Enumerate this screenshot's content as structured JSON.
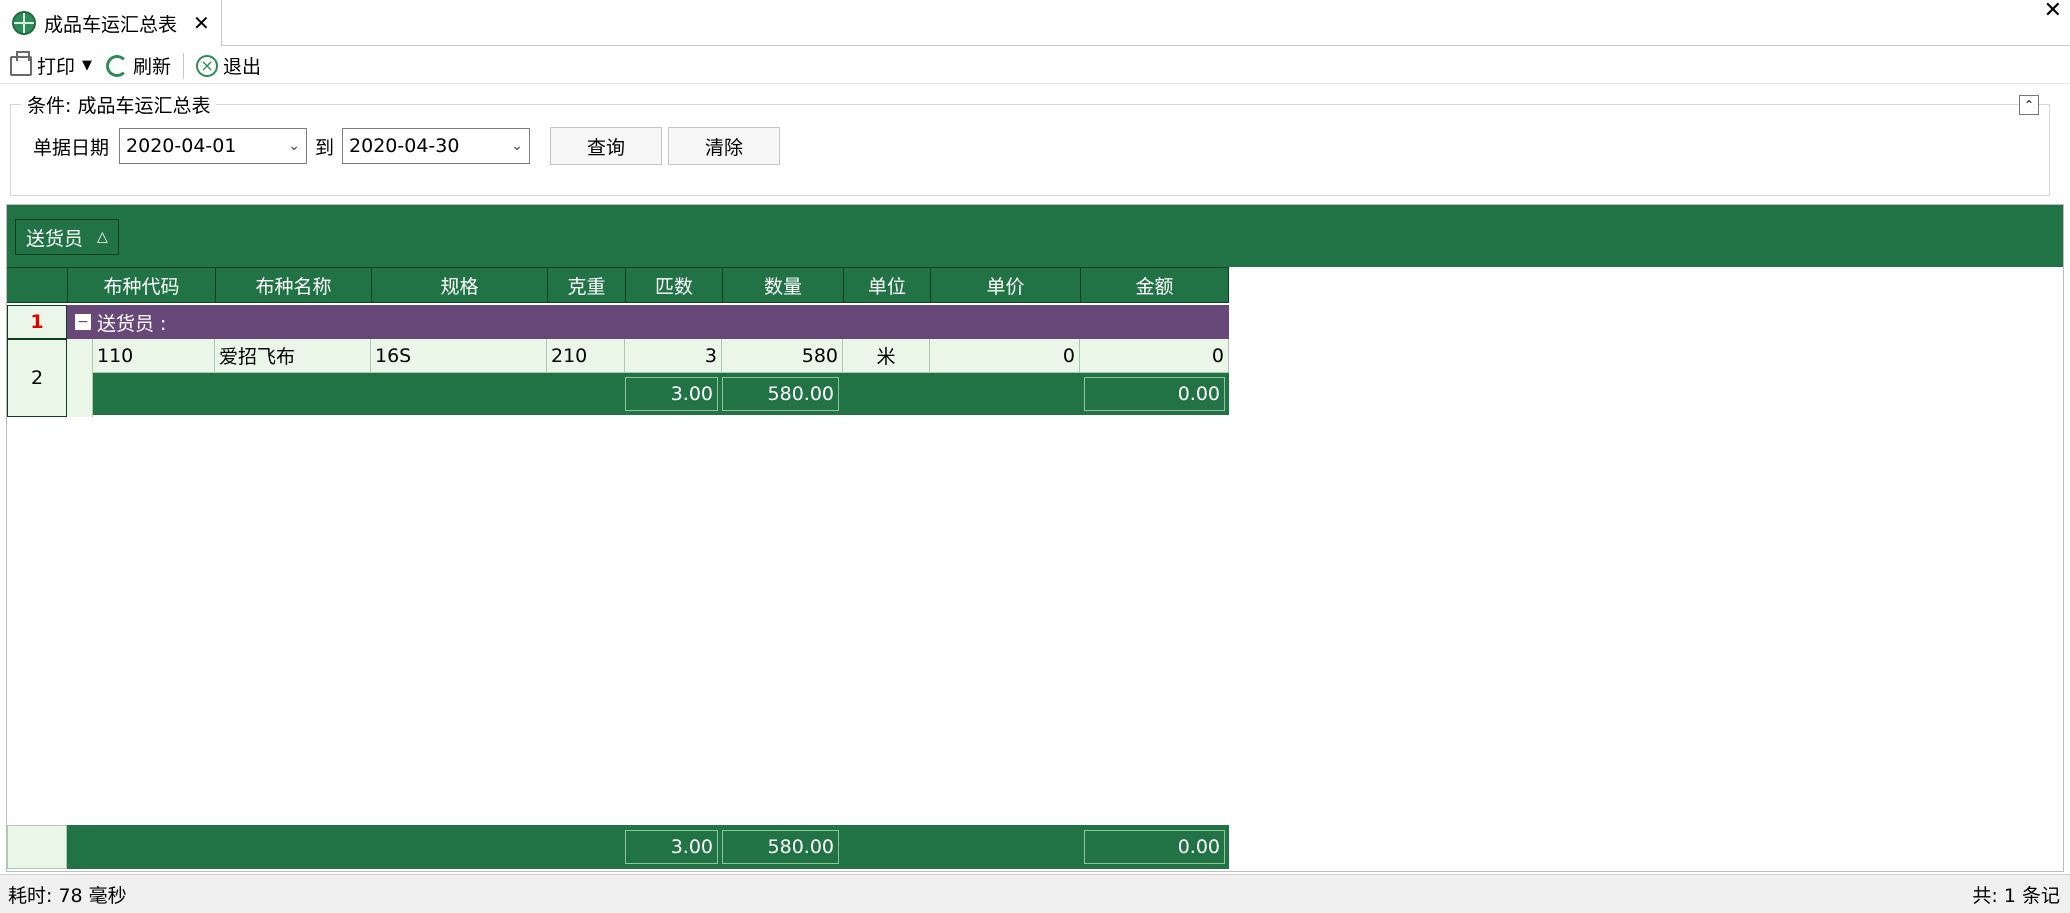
{
  "tab": {
    "title": "成品车运汇总表",
    "close": "✕"
  },
  "window": {
    "close": "✕"
  },
  "toolbar": {
    "print": "打印",
    "refresh": "刷新",
    "exit": "退出"
  },
  "condition": {
    "legend": "条件: 成品车运汇总表",
    "date_label": "单据日期",
    "date_from": "2020-04-01",
    "to_label": "到",
    "date_to": "2020-04-30",
    "query_button": "查询",
    "clear_button": "清除"
  },
  "grid": {
    "group_by": "送货员",
    "columns": [
      "布种代码",
      "布种名称",
      "规格",
      "克重",
      "匹数",
      "数量",
      "单位",
      "单价",
      "金额"
    ],
    "group_row": {
      "indicator": "1",
      "label": "送货员 :"
    },
    "rows": [
      {
        "indicator": "2",
        "code": "110",
        "name": "爱招飞布",
        "spec": "16S",
        "weight": "210",
        "pieces": "3",
        "qty": "580",
        "unit": "米",
        "price": "0",
        "amount": "0"
      }
    ],
    "group_summary": {
      "pieces": "3.00",
      "qty": "580.00",
      "amount": "0.00"
    },
    "grand_summary": {
      "pieces": "3.00",
      "qty": "580.00",
      "amount": "0.00"
    }
  },
  "status": {
    "elapsed": "耗时: 78 毫秒",
    "count": "共: 1 条记"
  }
}
